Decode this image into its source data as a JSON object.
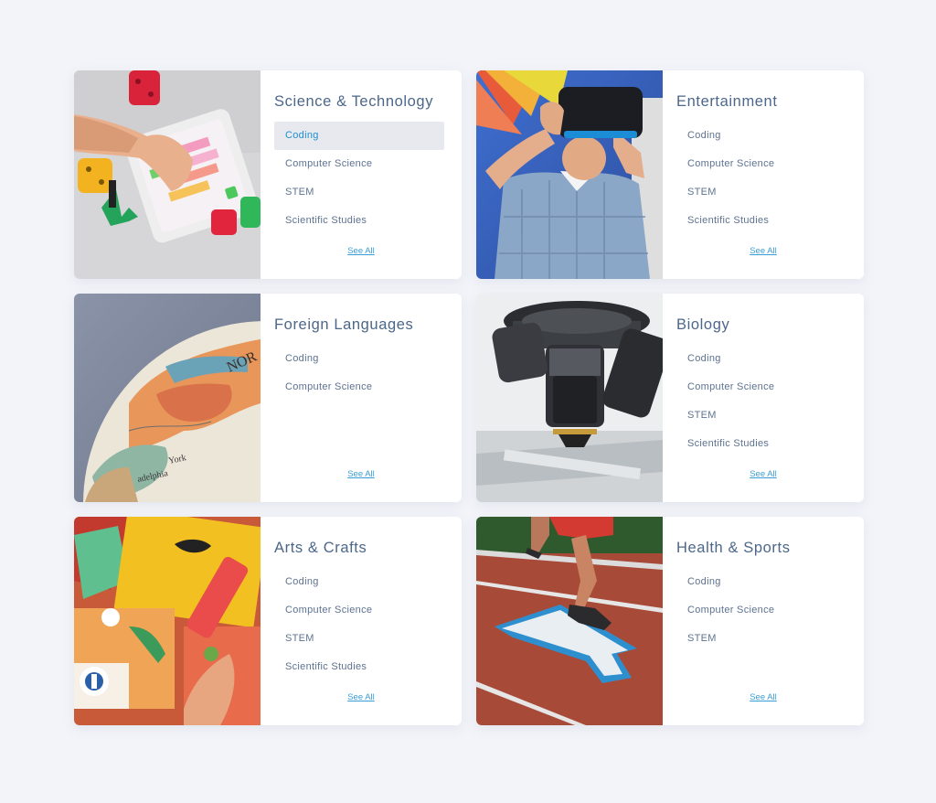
{
  "cards": [
    {
      "title": "Science & Technology",
      "image": "kid-tablet-coding-photo",
      "items": [
        {
          "label": "Coding",
          "active": true
        },
        {
          "label": "Computer Science"
        },
        {
          "label": "STEM"
        },
        {
          "label": "Scientific Studies"
        }
      ],
      "see_all": "See All"
    },
    {
      "title": "Entertainment",
      "image": "vr-headset-child-photo",
      "items": [
        {
          "label": "Coding"
        },
        {
          "label": "Computer Science"
        },
        {
          "label": "STEM"
        },
        {
          "label": "Scientific Studies"
        }
      ],
      "see_all": "See All"
    },
    {
      "title": "Foreign Languages",
      "image": "globe-photo",
      "items": [
        {
          "label": "Coding"
        },
        {
          "label": "Computer Science"
        }
      ],
      "see_all": "See All"
    },
    {
      "title": "Biology",
      "image": "microscope-photo",
      "items": [
        {
          "label": "Coding"
        },
        {
          "label": "Computer Science"
        },
        {
          "label": "STEM"
        },
        {
          "label": "Scientific Studies"
        }
      ],
      "see_all": "See All"
    },
    {
      "title": "Arts & Crafts",
      "image": "paper-crafts-photo",
      "items": [
        {
          "label": "Coding"
        },
        {
          "label": "Computer Science"
        },
        {
          "label": "STEM"
        },
        {
          "label": "Scientific Studies"
        }
      ],
      "see_all": "See All"
    },
    {
      "title": "Health & Sports",
      "image": "running-track-photo",
      "items": [
        {
          "label": "Coding"
        },
        {
          "label": "Computer Science"
        },
        {
          "label": "STEM"
        }
      ],
      "see_all": "See All"
    }
  ],
  "colors": {
    "background": "#f3f4f9",
    "title": "#4c6789",
    "item_text": "#5d7290",
    "active_bg": "#e8e9ee",
    "active_text": "#1e8fce",
    "link": "#3a9ed6"
  }
}
